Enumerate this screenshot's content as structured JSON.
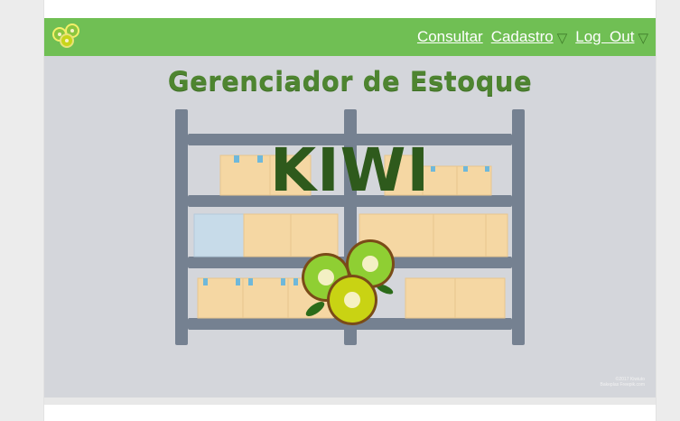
{
  "navbar": {
    "logo_icon": "kiwi-slices-icon",
    "links": {
      "consultar": "Consultar",
      "cadastro": "Cadastro",
      "logout": "Log  Out"
    },
    "dropdown_icon": "▽",
    "background": "#70bf54"
  },
  "hero": {
    "title": "Gerenciador de Estoque",
    "brand": "KIWI",
    "credit_line1": "©2017 Kiwiuto",
    "credit_line2": "Bakeplas Freepik.com",
    "background": "#d4d6db"
  },
  "colors": {
    "accent": "#70bf54",
    "title_green": "#4e8530",
    "brand_green": "#2e5a1c",
    "shelf": "#758191",
    "box": "#f5d7a3"
  }
}
